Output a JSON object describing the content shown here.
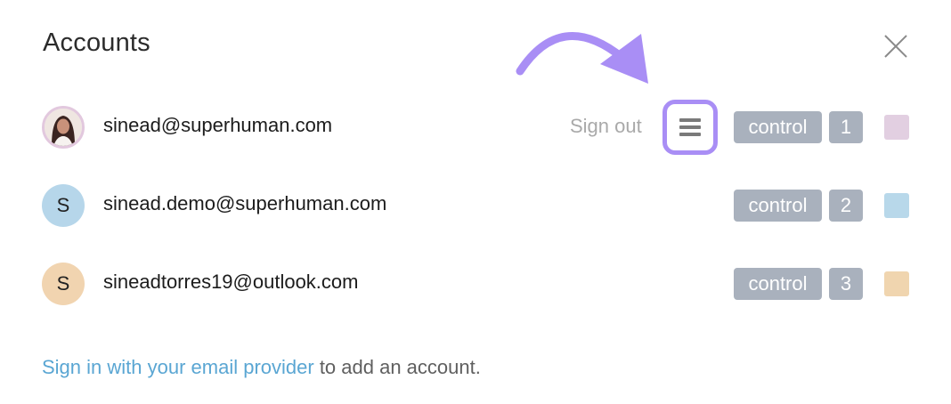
{
  "header": {
    "title": "Accounts"
  },
  "accounts": [
    {
      "email": "sinead@superhuman.com",
      "avatar_letter": "",
      "avatar_type": "photo",
      "sign_out": "Sign out",
      "badge": "control",
      "number": "1",
      "color": "#e2cfe1"
    },
    {
      "email": "sinead.demo@superhuman.com",
      "avatar_letter": "S",
      "avatar_type": "letter",
      "badge": "control",
      "number": "2",
      "color": "#b8d8ea",
      "avatar_color": "#b6d6ea"
    },
    {
      "email": "sineadtorres19@outlook.com",
      "avatar_letter": "S",
      "avatar_type": "letter",
      "badge": "control",
      "number": "3",
      "color": "#f0d5af",
      "avatar_color": "#f1d4b0"
    }
  ],
  "footer": {
    "link_text": "Sign in with your email provider",
    "rest_text": " to add an account."
  },
  "colors": {
    "accent_purple": "#a98ef5",
    "badge_bg": "#a9b1bd",
    "link": "#5aa6d3"
  },
  "icons": {
    "close": "close-icon",
    "menu": "hamburger-menu-icon",
    "arrow": "curved-arrow-icon"
  }
}
